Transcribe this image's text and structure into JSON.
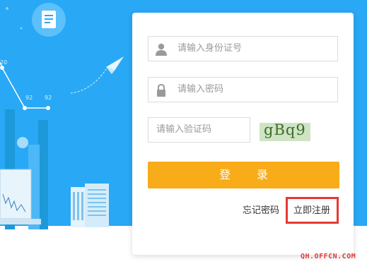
{
  "login": {
    "id_placeholder": "请输入身份证号",
    "password_placeholder": "请输入密码",
    "captcha_placeholder": "请输入验证码",
    "captcha_text": "gBq9",
    "login_label": "登 录",
    "forgot_label": "忘记密码",
    "register_label": "立即注册"
  },
  "illustration": {
    "tick_labels": [
      "20",
      "92",
      "92"
    ]
  },
  "watermark": "QH.OFFCN.COM",
  "colors": {
    "background": "#29a8f5",
    "login_button": "#f8ac19",
    "highlight_border": "#e53935"
  },
  "icons": {
    "document": "document-icon",
    "user": "user-icon",
    "lock": "lock-icon",
    "paper_plane": "paper-plane-icon"
  }
}
